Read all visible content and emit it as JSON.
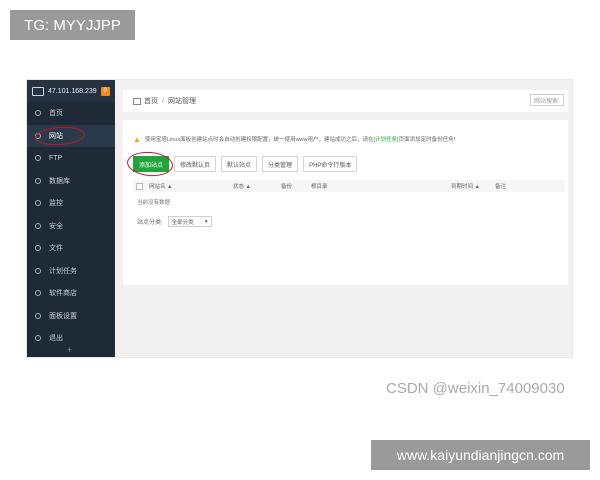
{
  "watermarks": {
    "tag": "TG: MYYJJPP",
    "csdn": "CSDN @weixin_74009030",
    "url": "www.kaiyundianjingcn.com"
  },
  "sidebar": {
    "server_ip": "47.101.168.239",
    "badge": "0",
    "items": [
      {
        "label": "首页"
      },
      {
        "label": "网站"
      },
      {
        "label": "FTP"
      },
      {
        "label": "数据库"
      },
      {
        "label": "监控"
      },
      {
        "label": "安全"
      },
      {
        "label": "文件"
      },
      {
        "label": "计划任务"
      },
      {
        "label": "软件商店"
      },
      {
        "label": "面板设置"
      },
      {
        "label": "退出"
      }
    ],
    "collapse_glyph": "+"
  },
  "breadcrumb": {
    "home": "首页",
    "separator": "/",
    "current": "网站管理"
  },
  "search": {
    "placeholder": "网站搜索"
  },
  "notice": {
    "text_before": "使用宝塔Linux面板创建站点时会自动创建权限配置，统一使用www用户。建站成功之后，请在",
    "link": "[计划任务]",
    "text_after": "页面添加定时备份任务!"
  },
  "toolbar": {
    "add_site": "添加站点",
    "edit_default_page": "修改默认页",
    "default_site": "默认站点",
    "category_manage": "分类管理",
    "php_cli": "PHP命令行版本"
  },
  "table": {
    "columns": {
      "name": "网站名 ▲",
      "status": "状态 ▲",
      "backup": "备份",
      "root": "根目录",
      "expire": "到期时间 ▲",
      "note": "备注"
    },
    "empty": "当前没有数据"
  },
  "filter": {
    "label": "站点分类:",
    "selected": "全部分类",
    "arrow": "▾"
  },
  "colors": {
    "sidebar_bg": "#1f2a37",
    "primary_green": "#20a53a",
    "annotation_red": "#c0182a"
  }
}
